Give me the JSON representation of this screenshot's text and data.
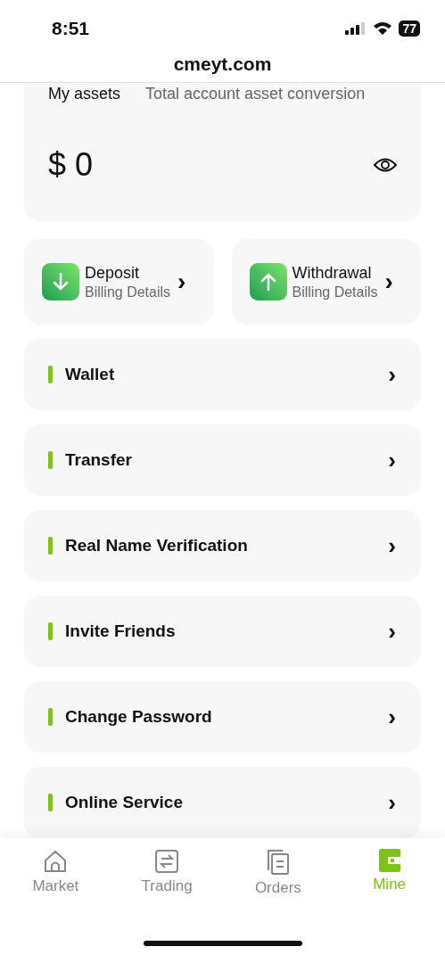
{
  "status_bar": {
    "time": "8:51",
    "battery": "77"
  },
  "address_bar": {
    "url": "cmeyt.com"
  },
  "assets": {
    "title": "My assets",
    "subtitle": "Total account asset conversion",
    "amount": "$ 0"
  },
  "actions": [
    {
      "kind": "deposit",
      "label": "Deposit",
      "sublabel": "Billing Details",
      "arrow": "›"
    },
    {
      "kind": "withdraw",
      "label": "Withdrawal",
      "sublabel": "Billing Details",
      "arrow": "›"
    }
  ],
  "menu": [
    {
      "label": "Wallet",
      "arrow": "›"
    },
    {
      "label": "Transfer",
      "arrow": "›"
    },
    {
      "label": "Real Name Verification",
      "arrow": "›"
    },
    {
      "label": "Invite Friends",
      "arrow": "›"
    },
    {
      "label": "Change Password",
      "arrow": "›"
    },
    {
      "label": "Online Service",
      "arrow": "›"
    }
  ],
  "tabs": [
    {
      "kind": "home",
      "label": "Market",
      "selected": false
    },
    {
      "kind": "swap",
      "label": "Trading",
      "selected": false
    },
    {
      "kind": "docs",
      "label": "Orders",
      "selected": false
    },
    {
      "kind": "wallet",
      "label": "Mine",
      "selected": true
    }
  ]
}
